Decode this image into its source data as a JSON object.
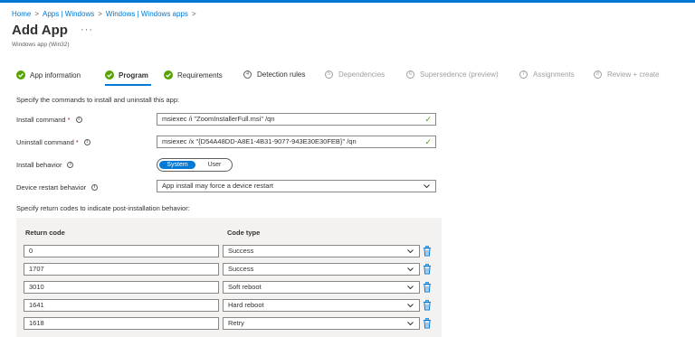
{
  "breadcrumb": [
    "Home",
    "Apps | Windows",
    "Windows | Windows apps"
  ],
  "page": {
    "title": "Add App",
    "more": "···",
    "subtitle": "Windows app (Win32)"
  },
  "steps": [
    {
      "label": "App information",
      "state": "done"
    },
    {
      "label": "Program",
      "state": "current"
    },
    {
      "label": "Requirements",
      "state": "done"
    },
    {
      "label": "Detection rules",
      "state": "upcoming",
      "num": "4"
    },
    {
      "label": "Dependencies",
      "state": "pending",
      "num": "5"
    },
    {
      "label": "Supersedence (preview)",
      "state": "pending",
      "num": "6"
    },
    {
      "label": "Assignments",
      "state": "pending",
      "num": "7"
    },
    {
      "label": "Review + create",
      "state": "pending",
      "num": "8"
    }
  ],
  "program": {
    "instruction": "Specify the commands to install and uninstall this app:",
    "install_label": "Install command",
    "install_value": "msiexec /i \"ZoomInstallerFull.msi\" /qn",
    "uninstall_label": "Uninstall command",
    "uninstall_value": "msiexec /x \"{D54A48DD-A8E1-4B31-9077-943E30E30FEB}\" /qn",
    "behavior_label": "Install behavior",
    "behavior_options": [
      "System",
      "User"
    ],
    "behavior_selected": "System",
    "restart_label": "Device restart behavior",
    "restart_value": "App install may force a device restart",
    "required_marker": "*",
    "info_glyph": "i"
  },
  "return_codes": {
    "instruction": "Specify return codes to indicate post-installation behavior:",
    "col_code": "Return code",
    "col_type": "Code type",
    "rows": [
      {
        "code": "0",
        "type": "Success"
      },
      {
        "code": "1707",
        "type": "Success"
      },
      {
        "code": "3010",
        "type": "Soft reboot"
      },
      {
        "code": "1641",
        "type": "Hard reboot"
      },
      {
        "code": "1618",
        "type": "Retry"
      }
    ]
  },
  "icons": {
    "step_done": "checkmark-circle-icon",
    "field_valid": "checkmark-icon",
    "dropdown": "chevron-down-icon",
    "delete": "trash-icon",
    "info": "info-icon"
  },
  "colors": {
    "accent": "#0078d4",
    "success": "#57a300",
    "required": "#a4262c"
  }
}
